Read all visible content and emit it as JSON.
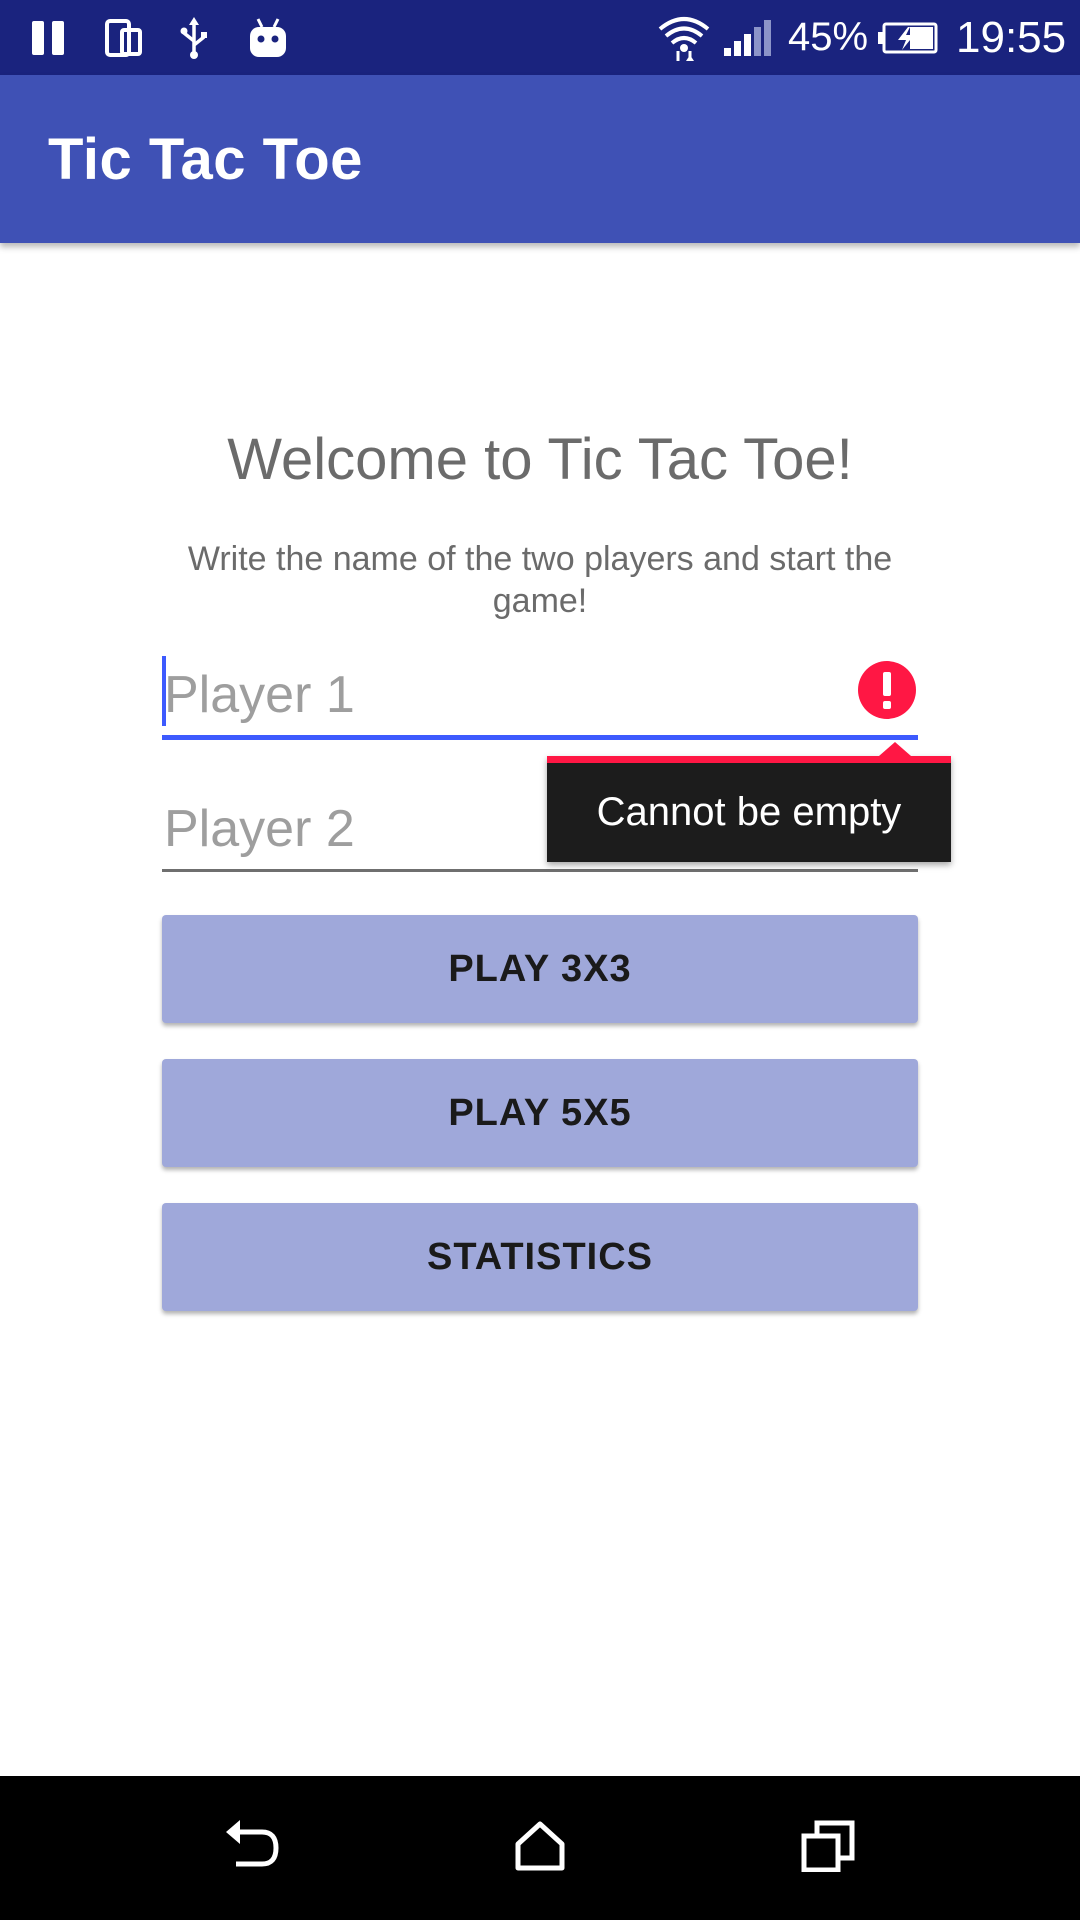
{
  "status_bar": {
    "battery_percent": "45%",
    "time": "19:55",
    "icons": [
      "pause-icon",
      "phone-icon",
      "usb-icon",
      "android-icon",
      "wifi-icon",
      "signal-icon",
      "battery-icon"
    ]
  },
  "app_bar": {
    "title": "Tic Tac Toe"
  },
  "main": {
    "welcome_title": "Welcome to Tic Tac Toe!",
    "subtitle": "Write the name of the two players and start the game!",
    "player1": {
      "placeholder": "Player 1",
      "value": "",
      "error": "Cannot be empty"
    },
    "player2": {
      "placeholder": "Player 2",
      "value": ""
    },
    "buttons": {
      "play_3x3": "PLAY 3X3",
      "play_5x5": "PLAY 5X5",
      "statistics": "STATISTICS"
    }
  },
  "nav_bar": {
    "icons": [
      "back-icon",
      "home-icon",
      "recents-icon"
    ]
  },
  "colors": {
    "status_bar": "#1a237e",
    "app_bar": "#3f51b5",
    "button": "#9fa8da",
    "focus_underline": "#3d5afe",
    "error": "#ff1744"
  }
}
